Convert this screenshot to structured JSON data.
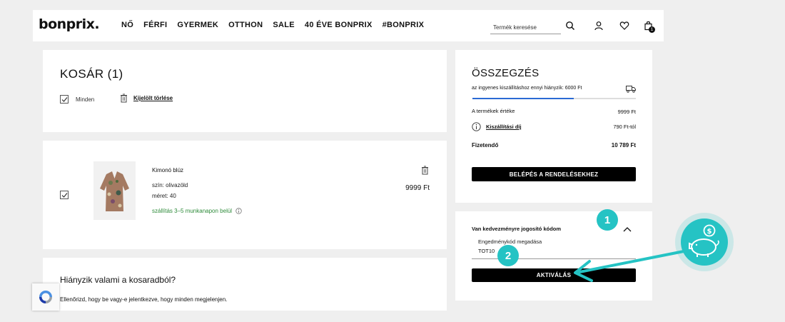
{
  "header": {
    "logo": "bonprix.",
    "nav": [
      "NŐ",
      "FÉRFI",
      "GYERMEK",
      "OTTHON",
      "SALE",
      "40 ÉVE BONPRIX",
      "#BONPRIX"
    ],
    "search_placeholder": "Termék keresése",
    "cart_count": "1"
  },
  "cart": {
    "title": "KOSÁR (1)",
    "select_all": "Minden",
    "delete_selected": "Kijelölt törlése"
  },
  "product": {
    "name": "Kimonó blúz",
    "color": "szín: olivazöld",
    "size": "méret: 40",
    "delivery": "szállítás 3–5 munkanapon belül",
    "price": "9999 Ft"
  },
  "missing": {
    "title": "Hiányzik valami a kosaradból?",
    "text": "Ellenőrizd, hogy be vagy-e jelentkezve, hogy minden megjelenjen."
  },
  "summary": {
    "title": "ÖSSZEGZÉS",
    "free_shipping": "az ingyenes kiszállításhoz ennyi hiányzik: 6000 Ft",
    "progress": 0.62,
    "product_value_label": "A termékek értéke",
    "product_value": "9999 Ft",
    "shipping_label": "Kiszállítási díj",
    "shipping_value": "790 Ft-tól",
    "total_label": "Fizetendő",
    "total_value": "10 789 Ft",
    "checkout_button": "BELÉPÉS A RENDELÉSEKHEZ"
  },
  "coupon": {
    "title": "Van kedvezményre jogosító kódom",
    "field_label": "Engedménykód megadása",
    "field_value": "TOT10",
    "button": "AKTIVÁLÁS"
  },
  "annotations": {
    "step1": "1",
    "step2": "2"
  },
  "colors": {
    "accent_teal": "#25c3c4",
    "delivery_green": "#2e8b3a",
    "progress_blue": "#2b6ad4"
  }
}
